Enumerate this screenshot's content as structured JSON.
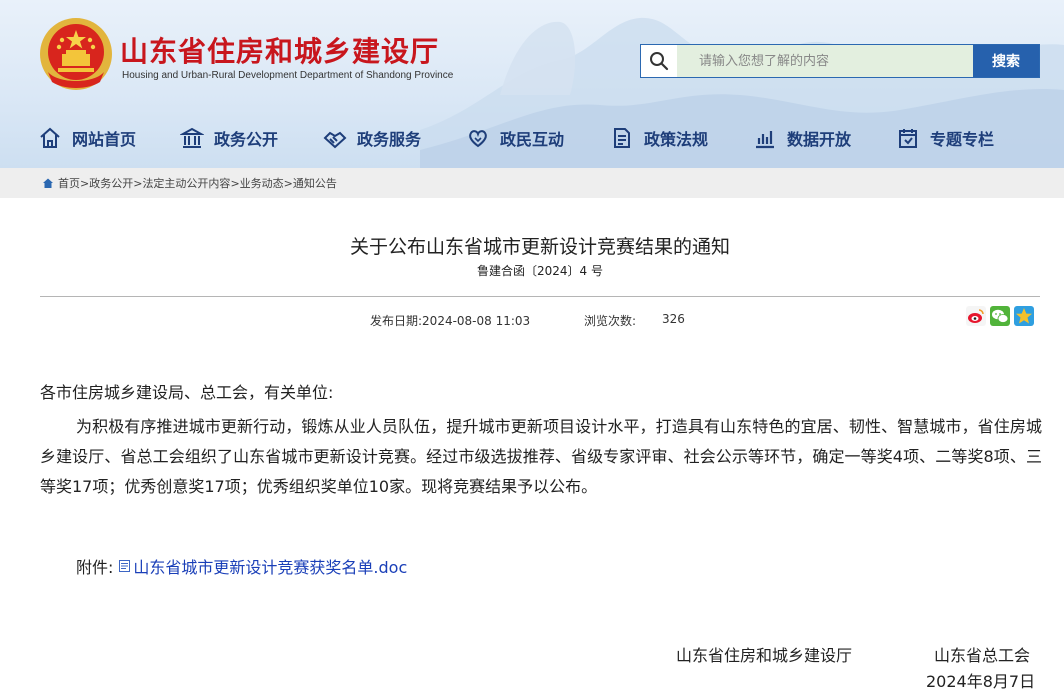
{
  "header": {
    "title": "山东省住房和城乡建设厅",
    "subtitle": "Housing and Urban-Rural Development Department of Shandong Province",
    "search_placeholder": "请输入您想了解的内容",
    "search_button": "搜索",
    "brand_color": "#c8161d",
    "accent_color": "#2661ad"
  },
  "nav": [
    {
      "label": "网站首页",
      "icon": "home-icon"
    },
    {
      "label": "政务公开",
      "icon": "building-icon"
    },
    {
      "label": "政务服务",
      "icon": "handshake-icon"
    },
    {
      "label": "政民互动",
      "icon": "heart-hand-icon"
    },
    {
      "label": "政策法规",
      "icon": "document-icon"
    },
    {
      "label": "数据开放",
      "icon": "bar-chart-icon"
    },
    {
      "label": "专题专栏",
      "icon": "calendar-icon"
    }
  ],
  "breadcrumb": {
    "items": [
      "首页",
      "政务公开",
      "法定主动公开内容",
      "业务动态",
      "通知公告"
    ],
    "separator": ">"
  },
  "article": {
    "title": "关于公布山东省城市更新设计竞赛结果的通知",
    "doc_number": "鲁建合函〔2024〕4 号",
    "publish_label": "发布日期:",
    "publish_date": "2024-08-08 11:03",
    "views_label": "浏览次数:",
    "views": "326",
    "greeting": "各市住房城乡建设局、总工会，有关单位:",
    "body": "为积极有序推进城市更新行动，锻炼从业人员队伍，提升城市更新项目设计水平，打造具有山东特色的宜居、韧性、智慧城市，省住房城乡建设厅、省总工会组织了山东省城市更新设计竞赛。经过市级选拔推荐、省级专家评审、社会公示等环节，确定一等奖4项、二等奖8项、三等奖17项；优秀创意奖17项；优秀组织奖单位10家。现将竞赛结果予以公布。",
    "attachment_label": "附件:",
    "attachment_name": "山东省城市更新设计竞赛获奖名单.doc",
    "signers": [
      "山东省住房和城乡建设厅",
      "山东省总工会"
    ],
    "date": "2024年8月7日"
  },
  "share": [
    "weibo-icon",
    "wechat-icon",
    "qzone-icon"
  ]
}
